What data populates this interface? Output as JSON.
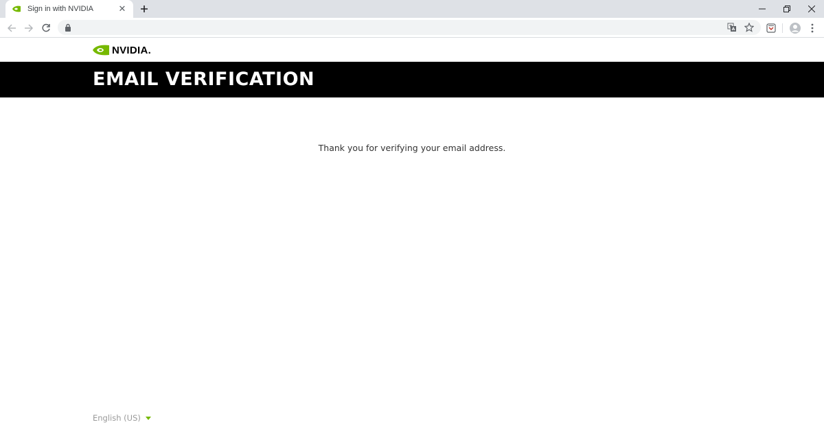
{
  "browser": {
    "tab_title": "Sign in with NVIDIA",
    "new_tab_label": "+",
    "address": ""
  },
  "site": {
    "logo_text": "NVIDIA.",
    "brand_color": "#76b900"
  },
  "banner": {
    "title": "EMAIL VERIFICATION"
  },
  "main": {
    "message": "Thank you for verifying your email address."
  },
  "footer": {
    "language": "English (US)"
  }
}
